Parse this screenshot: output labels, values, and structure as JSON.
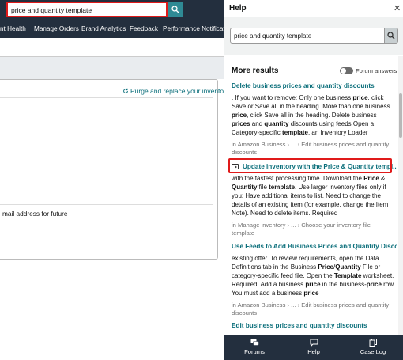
{
  "topbar": {
    "search_value": "price and quantity template"
  },
  "nav": {
    "items": [
      "nt Health",
      "Manage Orders",
      "Brand Analytics",
      "Feedback",
      "Performance Notification"
    ]
  },
  "page": {
    "purge_link": "Purge and replace your inventory",
    "email_note": "mail address for future"
  },
  "help": {
    "title": "Help",
    "search_value": "price and quantity template",
    "more_results": "More results",
    "forum_answers": "Forum answers",
    "results": [
      {
        "title": "Delete business prices and quantity discounts",
        "crumb": "in Amazon Business › ... › Edit business prices and quantity discounts"
      },
      {
        "title": "Update inventory with the Price & Quantity templ...",
        "crumb": "in Manage inventory › ... › Choose your inventory file template"
      },
      {
        "title": "Use Feeds to Add Business Prices and Quantity Discounts",
        "crumb": "in Amazon Business › ... › Edit business prices and quantity discounts"
      },
      {
        "title": "Edit business prices and quantity discounts"
      }
    ],
    "footer": {
      "forums": "Forums",
      "help": "Help",
      "caselog": "Case Log"
    }
  },
  "colors": {
    "nav_bg": "#232f3e",
    "link": "#0a6e7a",
    "highlight": "#e01a1a",
    "search_btn": "#2f8a94"
  }
}
